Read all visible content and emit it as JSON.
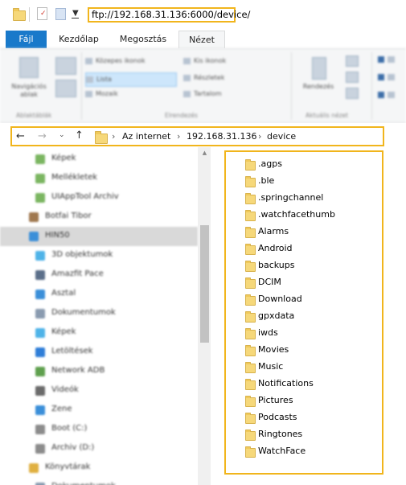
{
  "window": {
    "address_url": "ftp://192.168.31.136:6000/device/"
  },
  "ribbon_tabs": [
    "Fájl",
    "Kezdőlap",
    "Megosztás",
    "Nézet"
  ],
  "ribbon": {
    "nav_pane_label": "Navigációs ablak",
    "layout_options": [
      "Közepes ikonok",
      "Lista",
      "Mozaik",
      "Kis ikonok",
      "Részletek",
      "Tartalom"
    ],
    "group_panes": "Ablaktáblák",
    "group_layout": "Elrendezés",
    "sort_label": "Rendezés",
    "group_current_view": "Aktuális nézet"
  },
  "breadcrumb": [
    "Az internet",
    "192.168.31.136",
    "device"
  ],
  "nav_pane": {
    "items": [
      {
        "label": "Képek",
        "color": "#7bb661"
      },
      {
        "label": "Mellékletek",
        "color": "#7bb661"
      },
      {
        "label": "UIAppTool Archiv",
        "color": "#7bb661"
      },
      {
        "label": "Botfai Tibor",
        "color": "#a0784f"
      },
      {
        "label": "HIN50",
        "color": "#3b8fd9"
      },
      {
        "label": "3D objektumok",
        "color": "#4fb3e8"
      },
      {
        "label": "Amazfit Pace",
        "color": "#5b6f8a"
      },
      {
        "label": "Asztal",
        "color": "#3b8fd9"
      },
      {
        "label": "Dokumentumok",
        "color": "#8a9bb0"
      },
      {
        "label": "Képek",
        "color": "#4fb3e8"
      },
      {
        "label": "Letöltések",
        "color": "#2f7ed8"
      },
      {
        "label": "Network ADB",
        "color": "#5fa04e"
      },
      {
        "label": "Videók",
        "color": "#6b6b6b"
      },
      {
        "label": "Zene",
        "color": "#3b8fd9"
      },
      {
        "label": "Boot (C:)",
        "color": "#8c8c8c"
      },
      {
        "label": "Archiv (D:)",
        "color": "#8c8c8c"
      },
      {
        "label": "Könyvtárak",
        "color": "#e0b040"
      },
      {
        "label": "Dokumentumok",
        "color": "#8a9bb0"
      }
    ]
  },
  "files": [
    ".agps",
    ".ble",
    ".springchannel",
    ".watchfacethumb",
    "Alarms",
    "Android",
    "backups",
    "DCIM",
    "Download",
    "gpxdata",
    "iwds",
    "Movies",
    "Music",
    "Notifications",
    "Pictures",
    "Podcasts",
    "Ringtones",
    "WatchFace"
  ],
  "colors": {
    "highlight": "#f1b51c",
    "file_tab": "#1979ca",
    "folder": "#f6d87a"
  }
}
